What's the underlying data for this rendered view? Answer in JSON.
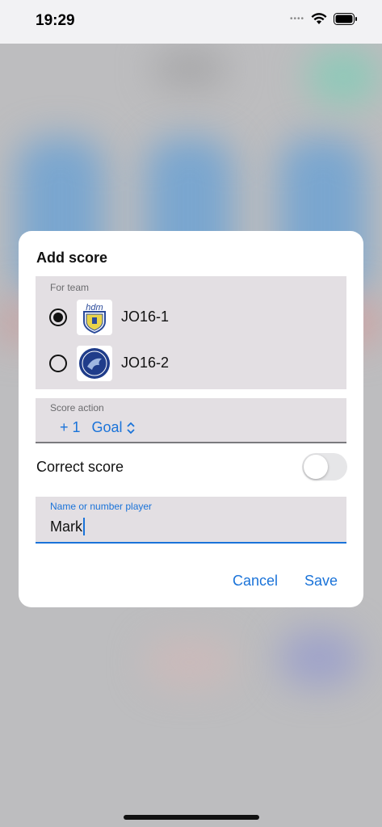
{
  "status_bar": {
    "time": "19:29"
  },
  "dialog": {
    "title": "Add score",
    "team_section": {
      "label": "For team",
      "teams": [
        {
          "name": "JO16-1",
          "selected": true,
          "logo": "hdm-crest-icon"
        },
        {
          "name": "JO16-2",
          "selected": false,
          "logo": "round-badge-icon"
        }
      ]
    },
    "score_action": {
      "label": "Score action",
      "points": "+ 1",
      "type": "Goal"
    },
    "correct_score": {
      "label": "Correct score",
      "enabled": false
    },
    "player_field": {
      "label": "Name or number player",
      "value": "Mark"
    },
    "buttons": {
      "cancel": "Cancel",
      "save": "Save"
    }
  },
  "colors": {
    "accent": "#1a73d9",
    "field_bg": "#e3dfe3",
    "dialog_bg": "#ffffff"
  }
}
